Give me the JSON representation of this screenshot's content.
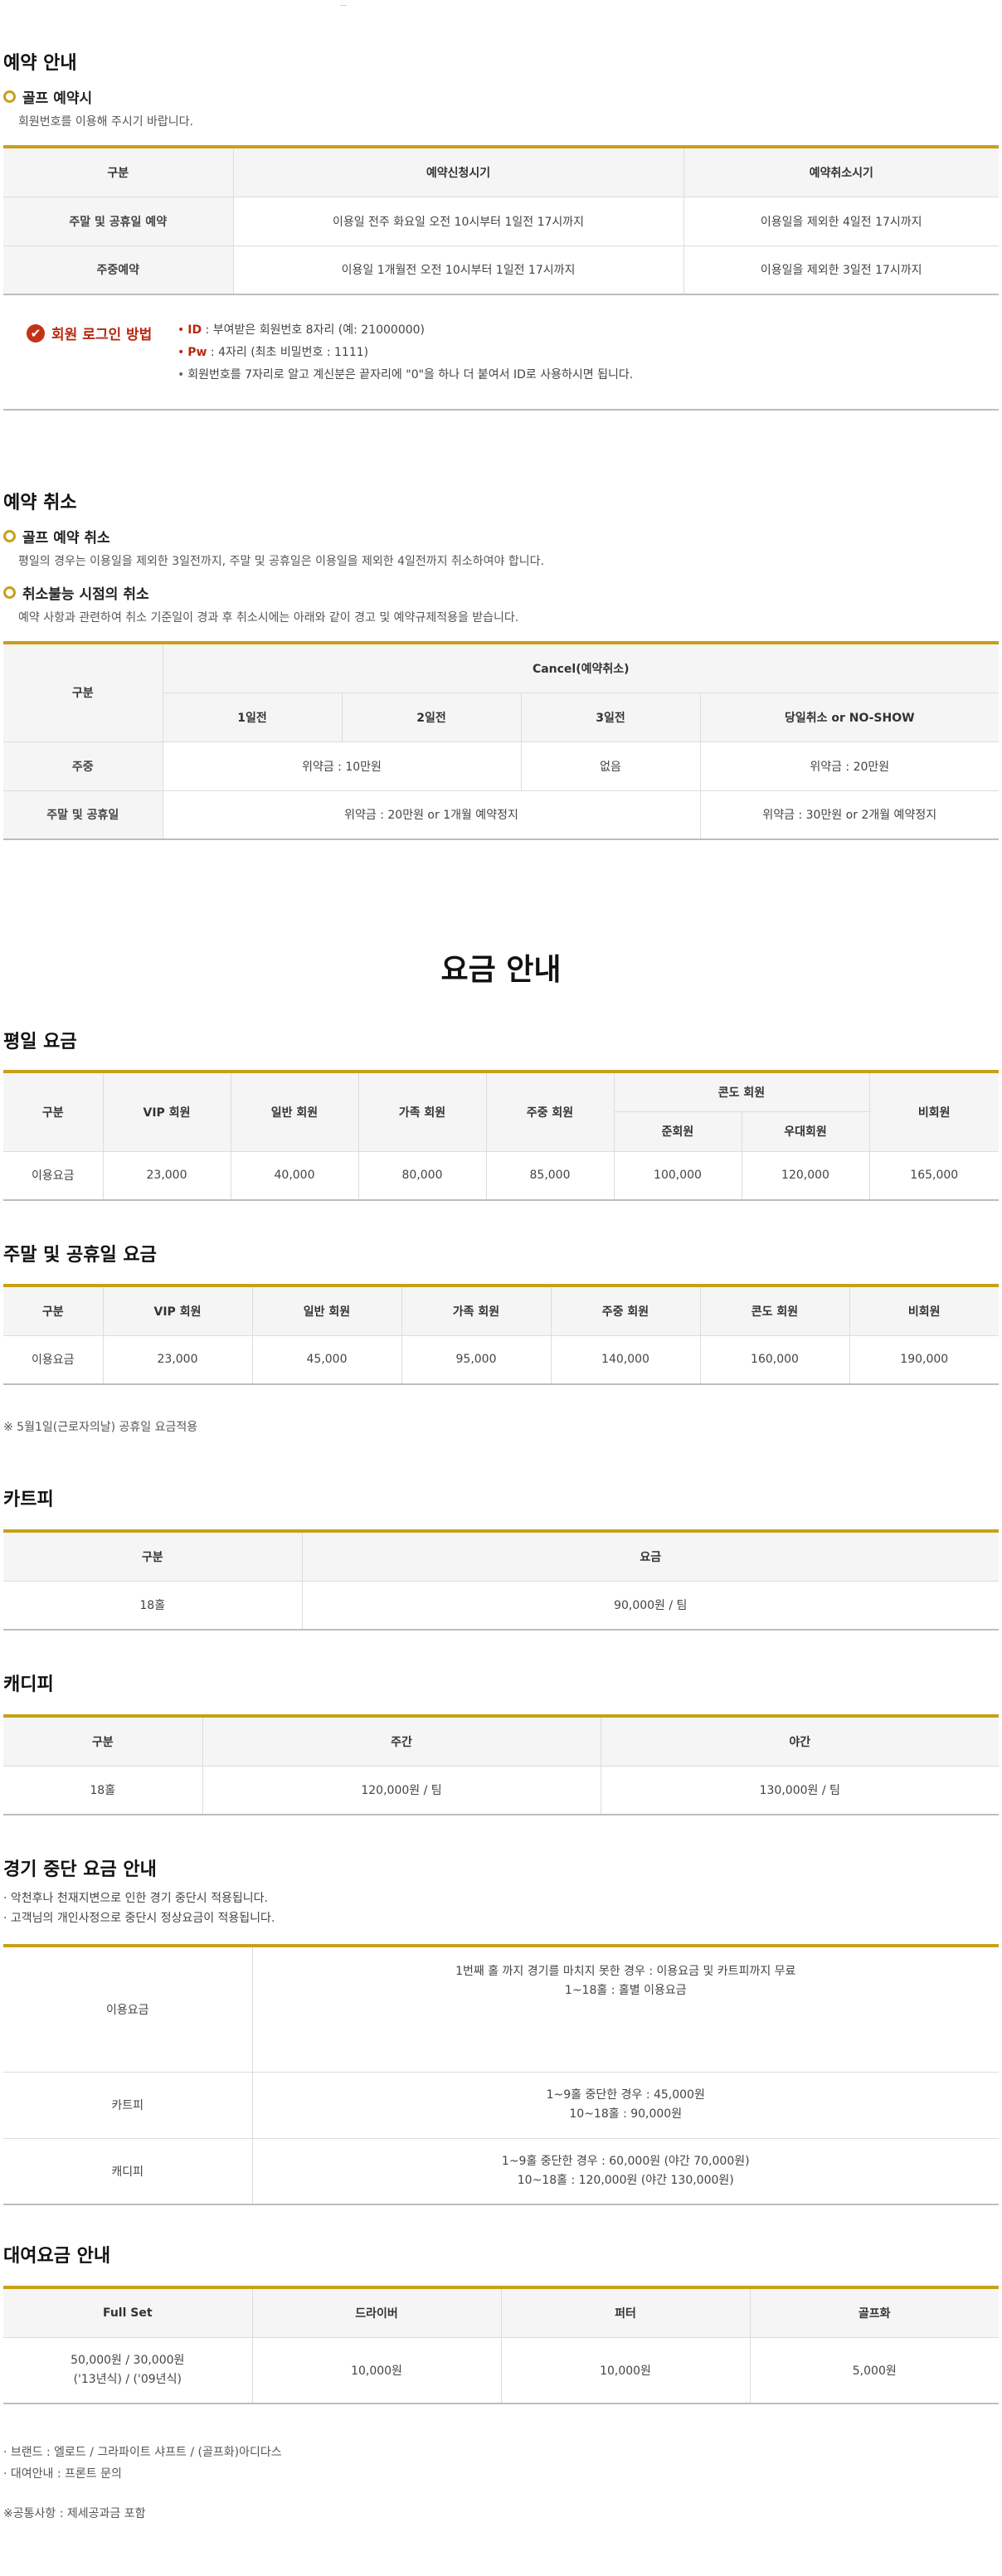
{
  "reservation": {
    "title": "예약 안내",
    "golf_reserve": {
      "label": "골프 예약시",
      "desc": "회원번호를 이용해 주시기 바랍니다."
    },
    "table": {
      "headers": [
        "구분",
        "예약신청시기",
        "예약취소시기"
      ],
      "rows": [
        [
          "주말 및 공휴일 예약",
          "이용일 전주 화요일 오전 10시부터 1일전 17시까지",
          "이용일을 제외한 4일전 17시까지"
        ],
        [
          "주중예약",
          "이용일 1개월전 오전 10시부터 1일전 17시까지",
          "이용일을 제외한 3일전 17시까지"
        ]
      ]
    },
    "login": {
      "title": "회원 로그인 방법",
      "id_label": "ID",
      "id_text": " : 부여받은 회원번호 8자리 (예: 21000000)",
      "pw_label": "Pw",
      "pw_text": " : 4자리 (최초 비밀번호 : 1111)",
      "note": "회원번호를 7자리로 알고 계신분은 끝자리에 \"0\"을 하나 더 붙여서 ID로 사용하시면 됩니다."
    }
  },
  "cancel": {
    "title": "예약 취소",
    "golf_cancel": {
      "label": "골프 예약 취소",
      "desc": "평일의 경우는 이용일을 제외한 3일전까지, 주말 및 공휴일은 이용일을 제외한 4일전까지 취소하여야 합니다."
    },
    "no_cancel": {
      "label": "취소불능 시점의 취소",
      "desc": "예약 사항과 관련하여 취소 기준일이 경과 후 취소시에는 아래와 같이 경고 및 예약규제적용을 받습니다."
    },
    "table": {
      "h_gubun": "구분",
      "h_cancel": "Cancel(예약취소)",
      "h_cols": [
        "1일전",
        "2일전",
        "3일전",
        "당일취소 or NO-SHOW"
      ],
      "weekday": {
        "label": "주중",
        "c12": "위약금 : 10만원",
        "c3": "없음",
        "c4": "위약금 : 20만원"
      },
      "weekend": {
        "label": "주말 및 공휴일",
        "c123": "위약금 : 20만원 or 1개월 예약정지",
        "c4": "위약금 : 30만원 or 2개월 예약정지"
      }
    }
  },
  "fee": {
    "title": "요금 안내",
    "weekday": {
      "title": "평일 요금",
      "h_gubun": "구분",
      "h_cols": [
        "VIP 회원",
        "일반 회원",
        "가족 회원",
        "주중 회원"
      ],
      "h_condo": "콘도 회원",
      "h_condo_sub": [
        "준회원",
        "우대회원"
      ],
      "h_non": "비회원",
      "row_label": "이용요금",
      "values": [
        "23,000",
        "40,000",
        "80,000",
        "85,000",
        "100,000",
        "120,000",
        "165,000"
      ]
    },
    "weekend": {
      "title": "주말 및 공휴일 요금",
      "headers": [
        "구분",
        "VIP 회원",
        "일반 회원",
        "가족 회원",
        "주중 회원",
        "콘도 회원",
        "비회원"
      ],
      "row_label": "이용요금",
      "values": [
        "23,000",
        "45,000",
        "95,000",
        "140,000",
        "160,000",
        "190,000"
      ]
    },
    "holiday_note": "※ 5월1일(근로자의날) 공휴일 요금적용"
  },
  "cart": {
    "title": "카트피",
    "headers": [
      "구분",
      "요금"
    ],
    "row": [
      "18홀",
      "90,000원 / 팀"
    ]
  },
  "caddie": {
    "title": "캐디피",
    "headers": [
      "구분",
      "주간",
      "야간"
    ],
    "row": [
      "18홀",
      "120,000원 / 팀",
      "130,000원 / 팀"
    ]
  },
  "stop": {
    "title": "경기 중단 요금 안내",
    "notes": [
      "· 악천후나 천재지변으로 인한 경기 중단시 적용됩니다.",
      "· 고객님의 개인사정으로 중단시 정상요금이 적용됩니다."
    ],
    "rows": [
      {
        "label": "이용요금",
        "lines": [
          "1번째 홀 까지 경기를 마치지 못한 경우 : 이용요금 및 카트피까지 무료",
          "1~18홀 : 홀별 이용요금"
        ]
      },
      {
        "label": "카트피",
        "lines": [
          "1~9홀 중단한 경우 : 45,000원",
          "10~18홀 : 90,000원"
        ]
      },
      {
        "label": "캐디피",
        "lines": [
          "1~9홀 중단한 경우 : 60,000원 (야간 70,000원)",
          "10~18홀 : 120,000원 (야간 130,000원)"
        ]
      }
    ]
  },
  "rental": {
    "title": "대여요금 안내",
    "headers": [
      "Full Set",
      "드라이버",
      "퍼터",
      "골프화"
    ],
    "fullset_lines": [
      "50,000원 / 30,000원",
      "('13년식) / ('09년식)"
    ],
    "values": [
      "10,000원",
      "10,000원",
      "5,000원"
    ],
    "notes": [
      "· 브랜드 : 엘로드 / 그라파이트 샤프트 / (골프화)아디다스",
      "· 대여안내 : 프론트 문의"
    ],
    "tax_note": "※공통사항 : 제세공과금 포함"
  },
  "colors": {
    "accent_gold": "#c8a01a",
    "login_red": "#b8280f",
    "header_bg": "#f5f5f5"
  }
}
